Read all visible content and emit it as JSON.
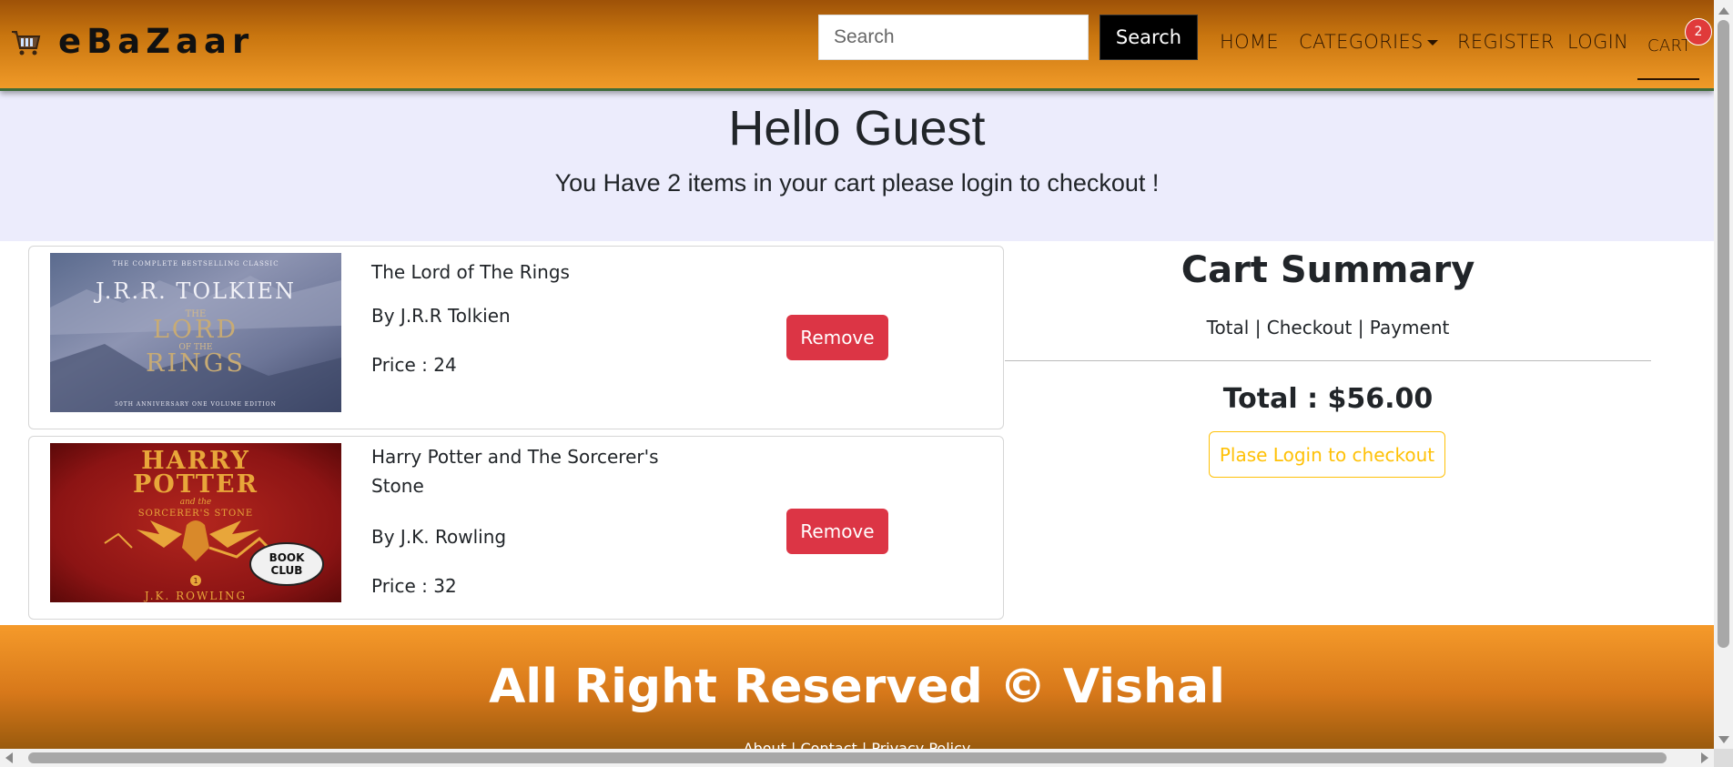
{
  "navbar": {
    "brand": "eBaZaar",
    "search_placeholder": "Search",
    "search_button": "Search",
    "links": {
      "home": "HOME",
      "categories": "CATEGORIES",
      "register": "REGISTER",
      "login": "LOGIN",
      "cart": "CART"
    },
    "cart_count": "2"
  },
  "hero": {
    "title": "Hello Guest",
    "subtitle": "You Have 2 items in your cart please login to checkout !"
  },
  "cart_items": [
    {
      "title": "The Lord of The Rings",
      "author": "By J.R.R Tolkien",
      "price": "Price : 24",
      "remove_label": "Remove",
      "cover": {
        "top_line": "THE COMPLETE BESTSELLING CLASSIC",
        "author": "J.R.R. TOLKIEN",
        "title_line1": "THE",
        "title_line2": "LORD",
        "title_line3": "OF THE",
        "title_line4": "RINGS",
        "bottom_line": "50TH ANNIVERSARY ONE VOLUME EDITION"
      }
    },
    {
      "title": "Harry Potter and The Sorcerer's Stone",
      "author": "By J.K. Rowling",
      "price": "Price : 32",
      "remove_label": "Remove",
      "cover": {
        "title_line1": "HARRY",
        "title_line2": "POTTER",
        "subtitle_and": "and the",
        "subtitle": "SORCERER'S STONE",
        "badge_line1": "BOOK",
        "badge_line2": "CLUB",
        "number": "1",
        "author": "J.K. ROWLING"
      }
    }
  ],
  "summary": {
    "title": "Cart Summary",
    "subtitle": "Total | Checkout | Payment",
    "total": "Total : $56.00",
    "login_button": "Plase Login to checkout"
  },
  "footer": {
    "text": "All Right Reserved © Vishal",
    "links": "About | Contact | Privacy Policy"
  },
  "colors": {
    "remove": "#dc3545",
    "login_outline": "#ffc107",
    "hero_bg": "#ececfc",
    "badge": "#e03a3a"
  }
}
